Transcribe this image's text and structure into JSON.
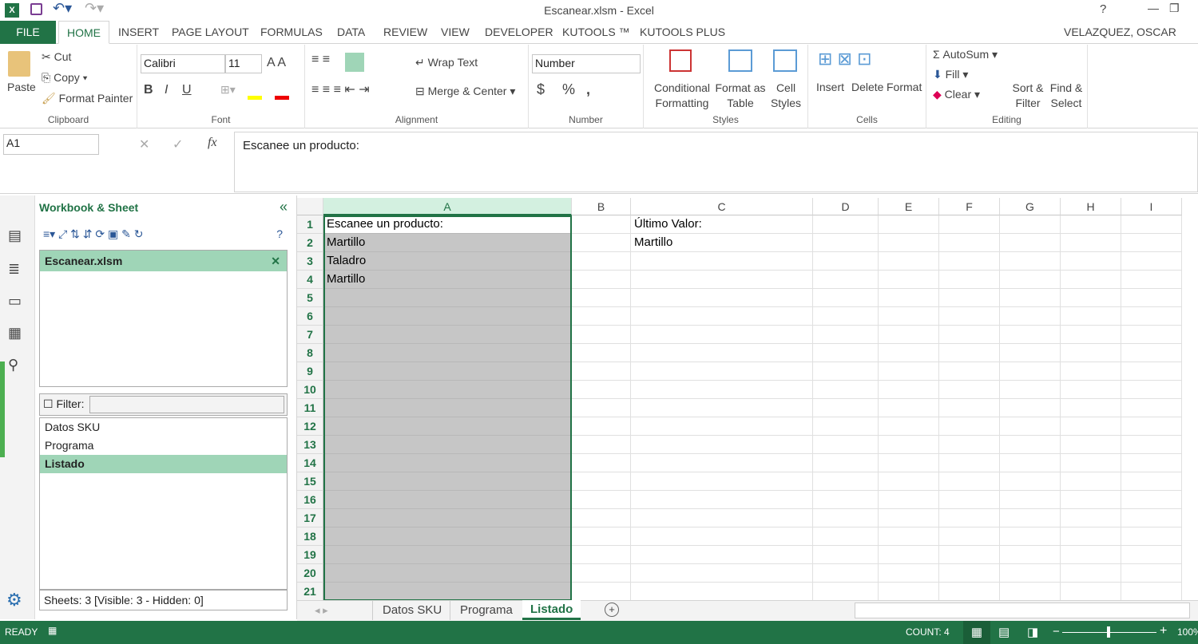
{
  "titlebar": {
    "title": "Escanear.xlsm - Excel",
    "help": "?",
    "user": "VELAZQUEZ, OSCAR"
  },
  "tabs": [
    "FILE",
    "HOME",
    "INSERT",
    "PAGE LAYOUT",
    "FORMULAS",
    "DATA",
    "REVIEW",
    "VIEW",
    "DEVELOPER",
    "KUTOOLS ™",
    "KUTOOLS PLUS"
  ],
  "active_tab": "HOME",
  "ribbon": {
    "clipboard": {
      "label": "Clipboard",
      "paste": "Paste",
      "cut": "Cut",
      "copy": "Copy",
      "format_painter": "Format Painter"
    },
    "font": {
      "label": "Font",
      "name": "Calibri",
      "size": "11",
      "bold": "B",
      "italic": "I",
      "underline": "U"
    },
    "alignment": {
      "label": "Alignment",
      "wrap": "Wrap Text",
      "merge": "Merge & Center"
    },
    "number": {
      "label": "Number",
      "format": "Number",
      "currency": "$",
      "percent": "%",
      "comma": ","
    },
    "styles": {
      "label": "Styles",
      "conditional": "Conditional Formatting",
      "format_table": "Format as Table",
      "cell_styles": "Cell Styles"
    },
    "cells": {
      "label": "Cells",
      "insert": "Insert",
      "delete": "Delete",
      "format": "Format"
    },
    "editing": {
      "label": "Editing",
      "autosum": "AutoSum",
      "fill": "Fill",
      "clear": "Clear",
      "sort": "Sort & Filter",
      "find": "Find & Select"
    }
  },
  "formula_bar": {
    "name_box": "A1",
    "fx": "fx",
    "value": "Escanee un producto:"
  },
  "pane": {
    "title": "Workbook & Sheet",
    "collapse": "«",
    "workbook": "Escanear.xlsm",
    "filter_label": "Filter:",
    "sheets": [
      "Datos SKU",
      "Programa",
      "Listado"
    ],
    "selected_sheet": "Listado",
    "footer": "Sheets: 3  [Visible: 3 - Hidden: 0]"
  },
  "grid": {
    "columns": [
      "A",
      "B",
      "C",
      "D",
      "E",
      "F",
      "G",
      "H",
      "I"
    ],
    "rows": [
      "1",
      "2",
      "3",
      "4",
      "5",
      "6",
      "7",
      "8",
      "9",
      "10",
      "11",
      "12",
      "13",
      "14",
      "15",
      "16",
      "17",
      "18",
      "19",
      "20",
      "21"
    ],
    "cells": {
      "A1": "Escanee un producto:",
      "A2": "Martillo",
      "A3": "Taladro",
      "A4": "Martillo",
      "C1": "Último Valor:",
      "C2": "Martillo"
    },
    "selected_column": "A"
  },
  "sheet_tabs": [
    "Datos SKU",
    "Programa",
    "Listado"
  ],
  "active_sheet": "Listado",
  "status": {
    "ready": "READY",
    "count": "COUNT: 4",
    "zoom": "100%"
  },
  "colors": {
    "accent": "#217346",
    "selection": "#c6c6c6",
    "active_header": "#d3f0e0"
  }
}
